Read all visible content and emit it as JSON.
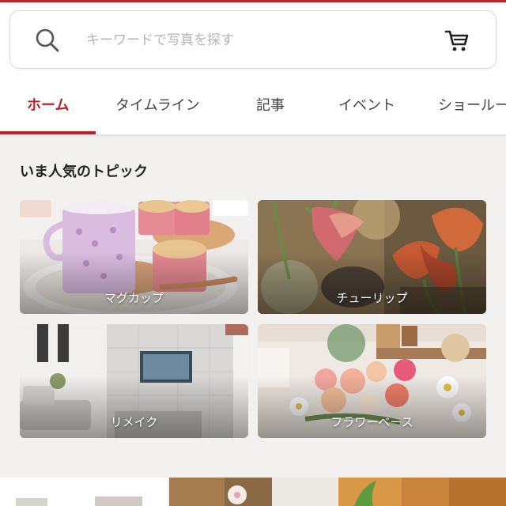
{
  "search": {
    "placeholder": "キーワードで写真を探す",
    "icon": "search-icon",
    "cart_icon": "cart-icon"
  },
  "tabs": [
    {
      "label": "ホーム",
      "active": true
    },
    {
      "label": "タイムライン",
      "active": false
    },
    {
      "label": "記事",
      "active": false
    },
    {
      "label": "イベント",
      "active": false
    },
    {
      "label": "ショールーム",
      "active": false
    }
  ],
  "colors": {
    "accent": "#b5252a",
    "background": "#f2f1ef"
  },
  "topics": {
    "title": "いま人気のトピック",
    "items": [
      {
        "label": "マグカップ"
      },
      {
        "label": "チューリップ"
      },
      {
        "label": "リメイク"
      },
      {
        "label": "フラワーベース"
      }
    ]
  }
}
